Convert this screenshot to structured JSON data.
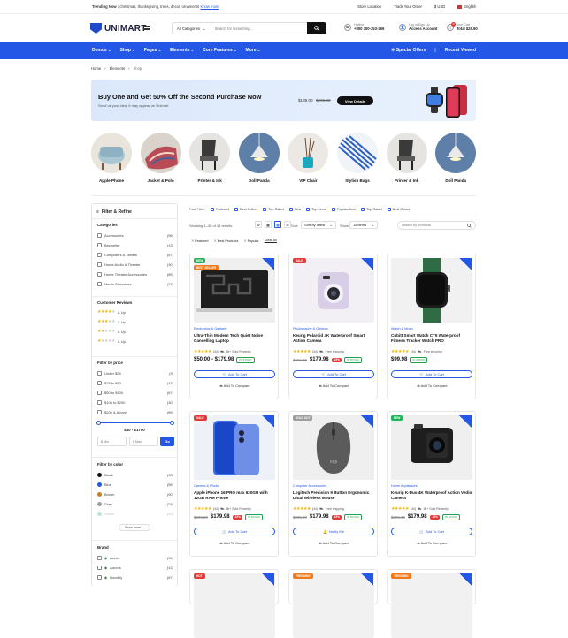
{
  "topbar": {
    "trending_label": "Trending Now :",
    "trending_text": "christmas, thanksgiving, trees, decor, ornaments",
    "know_more": "Know more",
    "store_location": "Store Location",
    "track_order": "Track Your Order",
    "currency": "$ USD",
    "language": "English"
  },
  "header": {
    "logo": "UNIMART",
    "category_select": "All Categories",
    "search_placeholder": "Search for something...",
    "hotline_label": "Hotline",
    "hotline_value": "+800 300-353-369",
    "account_label": "Log in/Sign Up",
    "account_value": "Access Account",
    "cart_label": "Your Cart",
    "cart_value": "Total $29.90",
    "cart_count": "0"
  },
  "nav": {
    "items": [
      "Demos",
      "Shop",
      "Pages",
      "Elements",
      "Core Features",
      "More"
    ],
    "special_offers": "Special Offers",
    "recent_viewed": "Recent Viewed"
  },
  "breadcrumb": [
    "Home",
    "Elements",
    "Shop"
  ],
  "banner": {
    "headline": "Buy One and Get 50% Off the Second Purchase Now",
    "sub": "Send us your idea, it may appear on Unimart",
    "price_new": "$189.00",
    "price_old": "$295.00",
    "cta": "View Details"
  },
  "categories": [
    {
      "label": "Apple Phone",
      "icon": "armchair-icon"
    },
    {
      "label": "Jacket & Polo",
      "icon": "fabric-icon"
    },
    {
      "label": "Printer & Ink",
      "icon": "chair-icon"
    },
    {
      "label": "Doll Panda",
      "icon": "lamp-icon"
    },
    {
      "label": "VIP Chair",
      "icon": "diffuser-icon"
    },
    {
      "label": "Stylish Bags",
      "icon": "blinds-icon"
    },
    {
      "label": "Printer & Ink",
      "icon": "chair-icon"
    },
    {
      "label": "Doll Panda",
      "icon": "lamp-icon"
    }
  ],
  "sidebar": {
    "title": "Filter & Refine",
    "categories_title": "Categories",
    "categories": [
      {
        "name": "Accessories",
        "count": "(96)"
      },
      {
        "name": "Bestseller",
        "count": "(13)"
      },
      {
        "name": "Computers & Tablets",
        "count": "(67)"
      },
      {
        "name": "Home Audio & Theatre",
        "count": "(30)"
      },
      {
        "name": "Home Theatre Accessories",
        "count": "(89)"
      },
      {
        "name": "Media Streamers",
        "count": "(27)"
      }
    ],
    "reviews_title": "Customer Reviews",
    "reviews": [
      "& Up",
      "& Up",
      "& Up",
      "& Up"
    ],
    "price_title": "Filter by price",
    "prices": [
      {
        "name": "Under $25",
        "count": "(9)"
      },
      {
        "name": "$25 to $50",
        "count": "(13)"
      },
      {
        "name": "$50 to $100",
        "count": "(67)"
      },
      {
        "name": "$100 to $200",
        "count": "(30)"
      },
      {
        "name": "$200 & Above",
        "count": "(89)"
      }
    ],
    "price_range": "$30 - $1700",
    "min_placeholder": "$ Min",
    "max_placeholder": "$ Max",
    "go": "Go",
    "color_title": "Filter by color",
    "colors": [
      {
        "name": "Black",
        "count": "(33)",
        "hex": "#111111"
      },
      {
        "name": "Blue",
        "count": "(56)",
        "hex": "#2457e6"
      },
      {
        "name": "Brown",
        "count": "(90)",
        "hex": "#c87f2c"
      },
      {
        "name": "Grey",
        "count": "(23)",
        "hex": "#a0a0a0"
      },
      {
        "name": "Green",
        "count": "(45)",
        "hex": "#3db36b"
      }
    ],
    "show_more": "Show more",
    "brand_title": "Brand",
    "brands": [
      {
        "name": "Acerio",
        "count": "(96)"
      },
      {
        "name": "Auroris",
        "count": "(13)"
      },
      {
        "name": "Novelify",
        "count": "(67)"
      }
    ]
  },
  "fast_filter": {
    "label": "Fast Filter:",
    "chips": [
      "Featured",
      "Best Sellers",
      "Top Rated",
      "New",
      "Top Items",
      "Popular Item",
      "Top Rated",
      "Best Colors"
    ]
  },
  "toolbar": {
    "showing": "Showing 1–30 of 48 results",
    "sort_label": "Sort:",
    "sort_value": "Sort by latest",
    "show_label": "Show:",
    "show_value": "15 items",
    "search_placeholder": "Search by products"
  },
  "active_filters": [
    "Featured",
    "Best Products",
    "Popular"
  ],
  "clear_all": "Clear All",
  "products": [
    {
      "badge": "NEW",
      "badge2": "BEST SELLER",
      "category": "Electronics & Gadgets",
      "title": "Ultra-Thin Modern Tech Quiet Noise Cancelling Laptop",
      "reviews": "(34)",
      "sold": "5k+ Sold Recently",
      "price": "$50.00 - $179.98",
      "old": "",
      "off": "",
      "instock": "IN STOCK",
      "cta": "Add To Cart",
      "compare": "Add To Compare"
    },
    {
      "badge": "SALE",
      "badge2": "",
      "category": "Photography & Outdoor",
      "title": "Keurig Polaroid 4K Waterproof Smart Action Camera",
      "reviews": "(34)",
      "sold": "Free shipping",
      "price": "$179.98",
      "old": "$295.00",
      "off": "-15%",
      "instock": "IN STOCK",
      "cta": "Add To Cart",
      "compare": "Add To Compare"
    },
    {
      "badge": "",
      "badge2": "",
      "category": "Watch & Music",
      "title": "Cubitt Smart Watch CT5 Waterproof Fitness Tracker Watch PRO",
      "reviews": "(34)",
      "sold": "Free shipping",
      "price": "$99.98",
      "old": "",
      "off": "",
      "instock": "IN STOCK",
      "cta": "Add To Cart",
      "compare": "Add To Compare"
    },
    {
      "badge": "SALE",
      "badge2": "",
      "category": "Camera & Photo",
      "title": "Apple iPhone 16 PRO max 620GU with 12GB RAM Phone",
      "reviews": "(34)",
      "sold": "5k+ Sold Recently",
      "price": "$179.98",
      "old": "$295.00",
      "off": "-15%",
      "instock": "IN STOCK",
      "cta": "Add To Cart",
      "compare": "Add To Compare"
    },
    {
      "badge": "SOLD OUT",
      "badge2": "",
      "category": "Computer Accessories",
      "title": "Logitech Precision 9 Button Ergonomic Dittal Wireless Mouse",
      "reviews": "(34)",
      "sold": "Free shipping",
      "price": "$179.98",
      "old": "$295.00",
      "off": "-15%",
      "instock": "IN STOCK",
      "cta": "Notify Me",
      "compare": "Add To Compare"
    },
    {
      "badge": "NEW",
      "badge2": "",
      "category": "Home Appliances",
      "title": "Keurig K-Duo 4K Waterproof Action Vedio Camera",
      "reviews": "(34)",
      "sold": "5k+ Sold Recently",
      "price": "$179.98",
      "old": "$295.00",
      "off": "-15%",
      "instock": "IN STOCK",
      "cta": "Add To Cart",
      "compare": "Add To Compare"
    }
  ],
  "bottom_badges": [
    "HOT",
    "TRENDING",
    "TRENDING"
  ],
  "colors": {
    "brand": "#2457e6",
    "sale": "#e53935",
    "new": "#20b45a",
    "star": "#f5b301"
  }
}
